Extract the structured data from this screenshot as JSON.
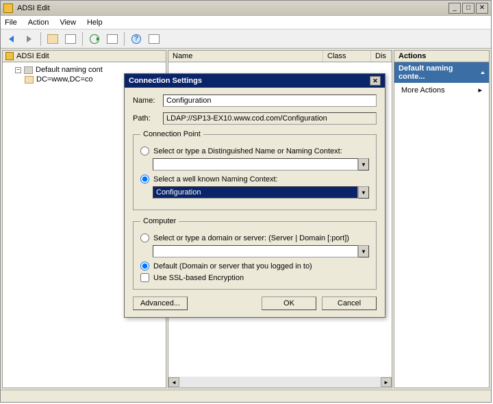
{
  "window": {
    "title": "ADSI Edit"
  },
  "menu": {
    "file": "File",
    "action": "Action",
    "view": "View",
    "help": "Help"
  },
  "tree": {
    "header": "ADSI Edit",
    "node1": "Default naming cont",
    "node2": "DC=www,DC=co"
  },
  "list": {
    "cols": {
      "name": "Name",
      "class": "Class",
      "dn": "Dis"
    }
  },
  "actions": {
    "header": "Actions",
    "section": "Default naming conte...",
    "more": "More Actions"
  },
  "dialog": {
    "title": "Connection Settings",
    "name_label": "Name:",
    "name_value": "Configuration",
    "path_label": "Path:",
    "path_value": "LDAP://SP13-EX10.www.cod.com/Configuration",
    "cp_legend": "Connection Point",
    "cp_opt1": "Select or type a Distinguished Name or Naming Context:",
    "cp_opt2": "Select a well known Naming Context:",
    "cp_value": "Configuration",
    "comp_legend": "Computer",
    "comp_opt1": "Select or type a domain or server: (Server | Domain [:port])",
    "comp_opt2": "Default (Domain or server that you logged in to)",
    "ssl": "Use SSL-based Encryption",
    "advanced": "Advanced...",
    "ok": "OK",
    "cancel": "Cancel"
  }
}
